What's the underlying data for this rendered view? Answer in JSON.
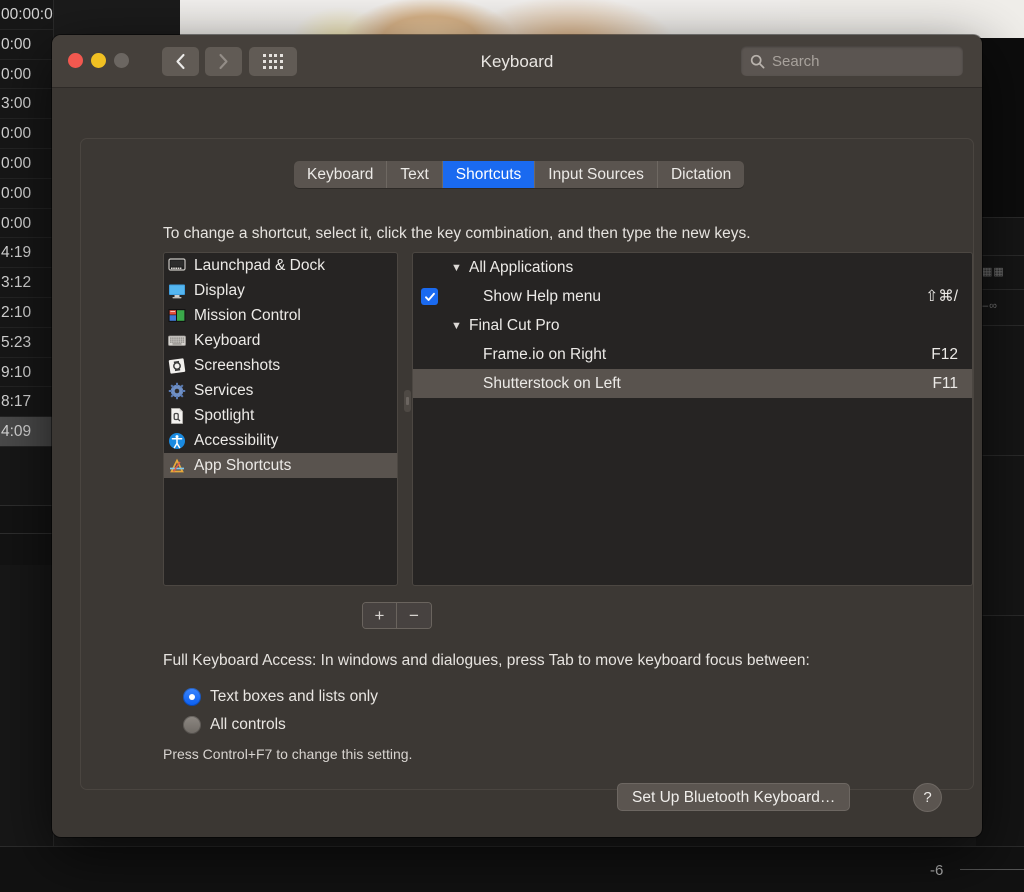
{
  "background": {
    "timecodes": [
      "0:00",
      "0:00",
      "3:00",
      "0:00",
      "0:00",
      "0:00",
      "0:00",
      "4:19",
      "3:12",
      "2:10",
      "5:23",
      "9:10",
      "8:17",
      "4:09"
    ],
    "selected_timecode": "4:09",
    "secondary_timecode": "00:00:0",
    "secondary_timecode_top": "00:00:0",
    "meter_label": "-6",
    "right_panel_marks": [
      "▦▦",
      "–∞"
    ]
  },
  "window": {
    "title": "Keyboard",
    "traffic_lights": [
      "close-red",
      "minimize-yellow",
      "zoom-gray"
    ],
    "nav": {
      "back": "chevron-left-icon",
      "forward": "chevron-right-icon",
      "grid": "show-all-icon"
    },
    "search": {
      "placeholder": "Search",
      "icon": "search-icon",
      "value": ""
    }
  },
  "tabs": [
    {
      "label": "Keyboard",
      "active": false
    },
    {
      "label": "Text",
      "active": false
    },
    {
      "label": "Shortcuts",
      "active": true
    },
    {
      "label": "Input Sources",
      "active": false
    },
    {
      "label": "Dictation",
      "active": false
    }
  ],
  "hint": "To change a shortcut, select it, click the key combination, and then type the new keys.",
  "categories": [
    {
      "label": "Launchpad & Dock",
      "icon": "launchpad-dock-icon",
      "selected": false
    },
    {
      "label": "Display",
      "icon": "display-icon",
      "selected": false
    },
    {
      "label": "Mission Control",
      "icon": "mission-control-icon",
      "selected": false
    },
    {
      "label": "Keyboard",
      "icon": "keyboard-icon",
      "selected": false
    },
    {
      "label": "Screenshots",
      "icon": "screenshots-icon",
      "selected": false
    },
    {
      "label": "Services",
      "icon": "services-gear-icon",
      "selected": false
    },
    {
      "label": "Spotlight",
      "icon": "spotlight-icon",
      "selected": false
    },
    {
      "label": "Accessibility",
      "icon": "accessibility-icon",
      "selected": false
    },
    {
      "label": "App Shortcuts",
      "icon": "app-shortcuts-icon",
      "selected": true
    }
  ],
  "shortcuts": [
    {
      "type": "group",
      "label": "All Applications",
      "expanded": true,
      "disclosure": "▼",
      "key": "",
      "checkbox": null,
      "selected": false
    },
    {
      "type": "item",
      "label": "Show Help menu",
      "key": "⇧⌘/",
      "checkbox": true,
      "selected": false
    },
    {
      "type": "group",
      "label": "Final Cut Pro",
      "expanded": true,
      "disclosure": "▼",
      "key": "",
      "checkbox": null,
      "selected": false
    },
    {
      "type": "item",
      "label": "Frame.io on Right",
      "key": "F12",
      "checkbox": null,
      "selected": false
    },
    {
      "type": "item",
      "label": "Shutterstock on Left",
      "key": "F11",
      "checkbox": null,
      "selected": true
    }
  ],
  "list_buttons": {
    "add": "+",
    "remove": "−"
  },
  "full_keyboard_access": {
    "label": "Full Keyboard Access: In windows and dialogues, press Tab to move keyboard focus between:",
    "options": [
      {
        "label": "Text boxes and lists only",
        "selected": true
      },
      {
        "label": "All controls",
        "selected": false
      }
    ],
    "note": "Press Control+F7 to change this setting."
  },
  "footer": {
    "bluetooth_button": "Set Up Bluetooth Keyboard…",
    "help_button": "?"
  },
  "colors": {
    "accent_blue": "#1a6af0",
    "window_bg": "#3b3733",
    "titlebar_bg": "#45403b",
    "list_bg": "#262423",
    "selection_gray": "#59534e",
    "text_primary": "#eceae7",
    "traffic_red": "#f2584f",
    "traffic_yellow": "#f0c022",
    "traffic_gray": "#6b6661"
  }
}
